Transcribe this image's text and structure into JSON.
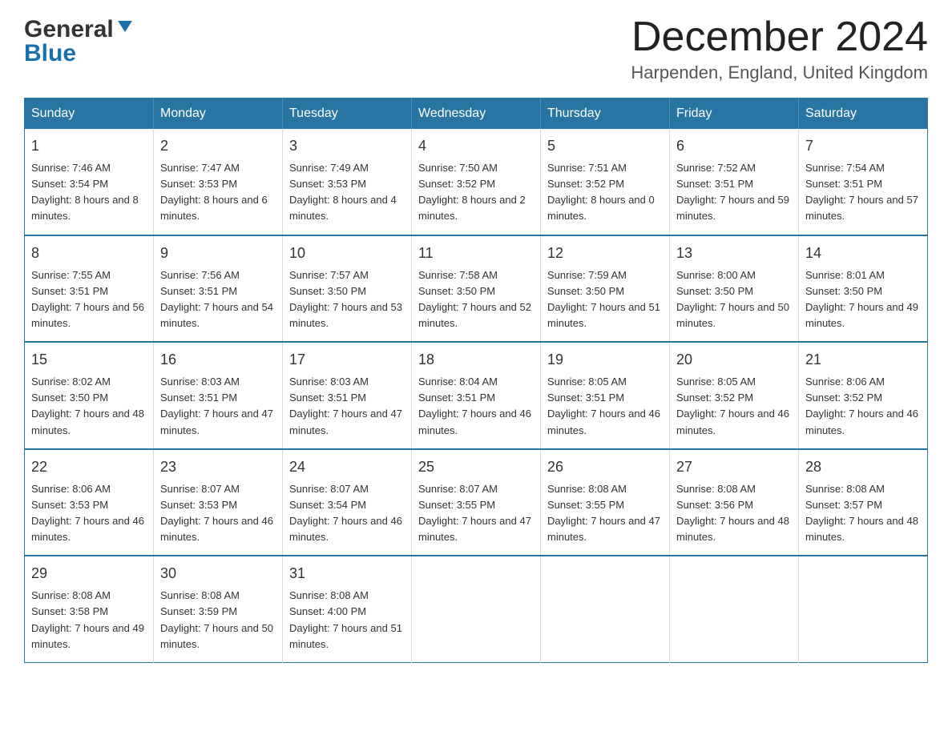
{
  "header": {
    "logo_general": "General",
    "logo_blue": "Blue",
    "month_title": "December 2024",
    "location": "Harpenden, England, United Kingdom"
  },
  "calendar": {
    "days_of_week": [
      "Sunday",
      "Monday",
      "Tuesday",
      "Wednesday",
      "Thursday",
      "Friday",
      "Saturday"
    ],
    "weeks": [
      [
        {
          "date": "1",
          "sunrise": "7:46 AM",
          "sunset": "3:54 PM",
          "daylight": "8 hours and 8 minutes."
        },
        {
          "date": "2",
          "sunrise": "7:47 AM",
          "sunset": "3:53 PM",
          "daylight": "8 hours and 6 minutes."
        },
        {
          "date": "3",
          "sunrise": "7:49 AM",
          "sunset": "3:53 PM",
          "daylight": "8 hours and 4 minutes."
        },
        {
          "date": "4",
          "sunrise": "7:50 AM",
          "sunset": "3:52 PM",
          "daylight": "8 hours and 2 minutes."
        },
        {
          "date": "5",
          "sunrise": "7:51 AM",
          "sunset": "3:52 PM",
          "daylight": "8 hours and 0 minutes."
        },
        {
          "date": "6",
          "sunrise": "7:52 AM",
          "sunset": "3:51 PM",
          "daylight": "7 hours and 59 minutes."
        },
        {
          "date": "7",
          "sunrise": "7:54 AM",
          "sunset": "3:51 PM",
          "daylight": "7 hours and 57 minutes."
        }
      ],
      [
        {
          "date": "8",
          "sunrise": "7:55 AM",
          "sunset": "3:51 PM",
          "daylight": "7 hours and 56 minutes."
        },
        {
          "date": "9",
          "sunrise": "7:56 AM",
          "sunset": "3:51 PM",
          "daylight": "7 hours and 54 minutes."
        },
        {
          "date": "10",
          "sunrise": "7:57 AM",
          "sunset": "3:50 PM",
          "daylight": "7 hours and 53 minutes."
        },
        {
          "date": "11",
          "sunrise": "7:58 AM",
          "sunset": "3:50 PM",
          "daylight": "7 hours and 52 minutes."
        },
        {
          "date": "12",
          "sunrise": "7:59 AM",
          "sunset": "3:50 PM",
          "daylight": "7 hours and 51 minutes."
        },
        {
          "date": "13",
          "sunrise": "8:00 AM",
          "sunset": "3:50 PM",
          "daylight": "7 hours and 50 minutes."
        },
        {
          "date": "14",
          "sunrise": "8:01 AM",
          "sunset": "3:50 PM",
          "daylight": "7 hours and 49 minutes."
        }
      ],
      [
        {
          "date": "15",
          "sunrise": "8:02 AM",
          "sunset": "3:50 PM",
          "daylight": "7 hours and 48 minutes."
        },
        {
          "date": "16",
          "sunrise": "8:03 AM",
          "sunset": "3:51 PM",
          "daylight": "7 hours and 47 minutes."
        },
        {
          "date": "17",
          "sunrise": "8:03 AM",
          "sunset": "3:51 PM",
          "daylight": "7 hours and 47 minutes."
        },
        {
          "date": "18",
          "sunrise": "8:04 AM",
          "sunset": "3:51 PM",
          "daylight": "7 hours and 46 minutes."
        },
        {
          "date": "19",
          "sunrise": "8:05 AM",
          "sunset": "3:51 PM",
          "daylight": "7 hours and 46 minutes."
        },
        {
          "date": "20",
          "sunrise": "8:05 AM",
          "sunset": "3:52 PM",
          "daylight": "7 hours and 46 minutes."
        },
        {
          "date": "21",
          "sunrise": "8:06 AM",
          "sunset": "3:52 PM",
          "daylight": "7 hours and 46 minutes."
        }
      ],
      [
        {
          "date": "22",
          "sunrise": "8:06 AM",
          "sunset": "3:53 PM",
          "daylight": "7 hours and 46 minutes."
        },
        {
          "date": "23",
          "sunrise": "8:07 AM",
          "sunset": "3:53 PM",
          "daylight": "7 hours and 46 minutes."
        },
        {
          "date": "24",
          "sunrise": "8:07 AM",
          "sunset": "3:54 PM",
          "daylight": "7 hours and 46 minutes."
        },
        {
          "date": "25",
          "sunrise": "8:07 AM",
          "sunset": "3:55 PM",
          "daylight": "7 hours and 47 minutes."
        },
        {
          "date": "26",
          "sunrise": "8:08 AM",
          "sunset": "3:55 PM",
          "daylight": "7 hours and 47 minutes."
        },
        {
          "date": "27",
          "sunrise": "8:08 AM",
          "sunset": "3:56 PM",
          "daylight": "7 hours and 48 minutes."
        },
        {
          "date": "28",
          "sunrise": "8:08 AM",
          "sunset": "3:57 PM",
          "daylight": "7 hours and 48 minutes."
        }
      ],
      [
        {
          "date": "29",
          "sunrise": "8:08 AM",
          "sunset": "3:58 PM",
          "daylight": "7 hours and 49 minutes."
        },
        {
          "date": "30",
          "sunrise": "8:08 AM",
          "sunset": "3:59 PM",
          "daylight": "7 hours and 50 minutes."
        },
        {
          "date": "31",
          "sunrise": "8:08 AM",
          "sunset": "4:00 PM",
          "daylight": "7 hours and 51 minutes."
        },
        {
          "date": "",
          "sunrise": "",
          "sunset": "",
          "daylight": ""
        },
        {
          "date": "",
          "sunrise": "",
          "sunset": "",
          "daylight": ""
        },
        {
          "date": "",
          "sunrise": "",
          "sunset": "",
          "daylight": ""
        },
        {
          "date": "",
          "sunrise": "",
          "sunset": "",
          "daylight": ""
        }
      ]
    ]
  },
  "labels": {
    "sunrise": "Sunrise:",
    "sunset": "Sunset:",
    "daylight": "Daylight:"
  }
}
